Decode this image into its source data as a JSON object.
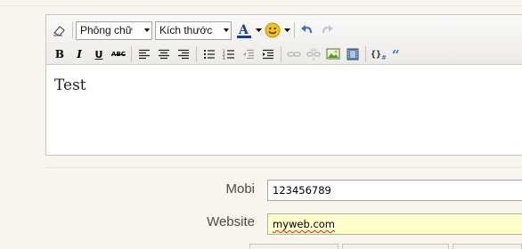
{
  "toolbar": {
    "font_select": "Phông chữ",
    "size_select": "Kích thước"
  },
  "editor": {
    "content": "Test"
  },
  "form": {
    "mobile": {
      "label": "Mobi",
      "value": "123456789"
    },
    "website": {
      "label": "Website",
      "value": "myweb.com"
    }
  },
  "colors": {
    "background": "#f8f5ef",
    "focused_input_bg": "#ffffcc",
    "link_blue": "#3a6fc4",
    "text_color_bar": "#1a3a9c"
  }
}
